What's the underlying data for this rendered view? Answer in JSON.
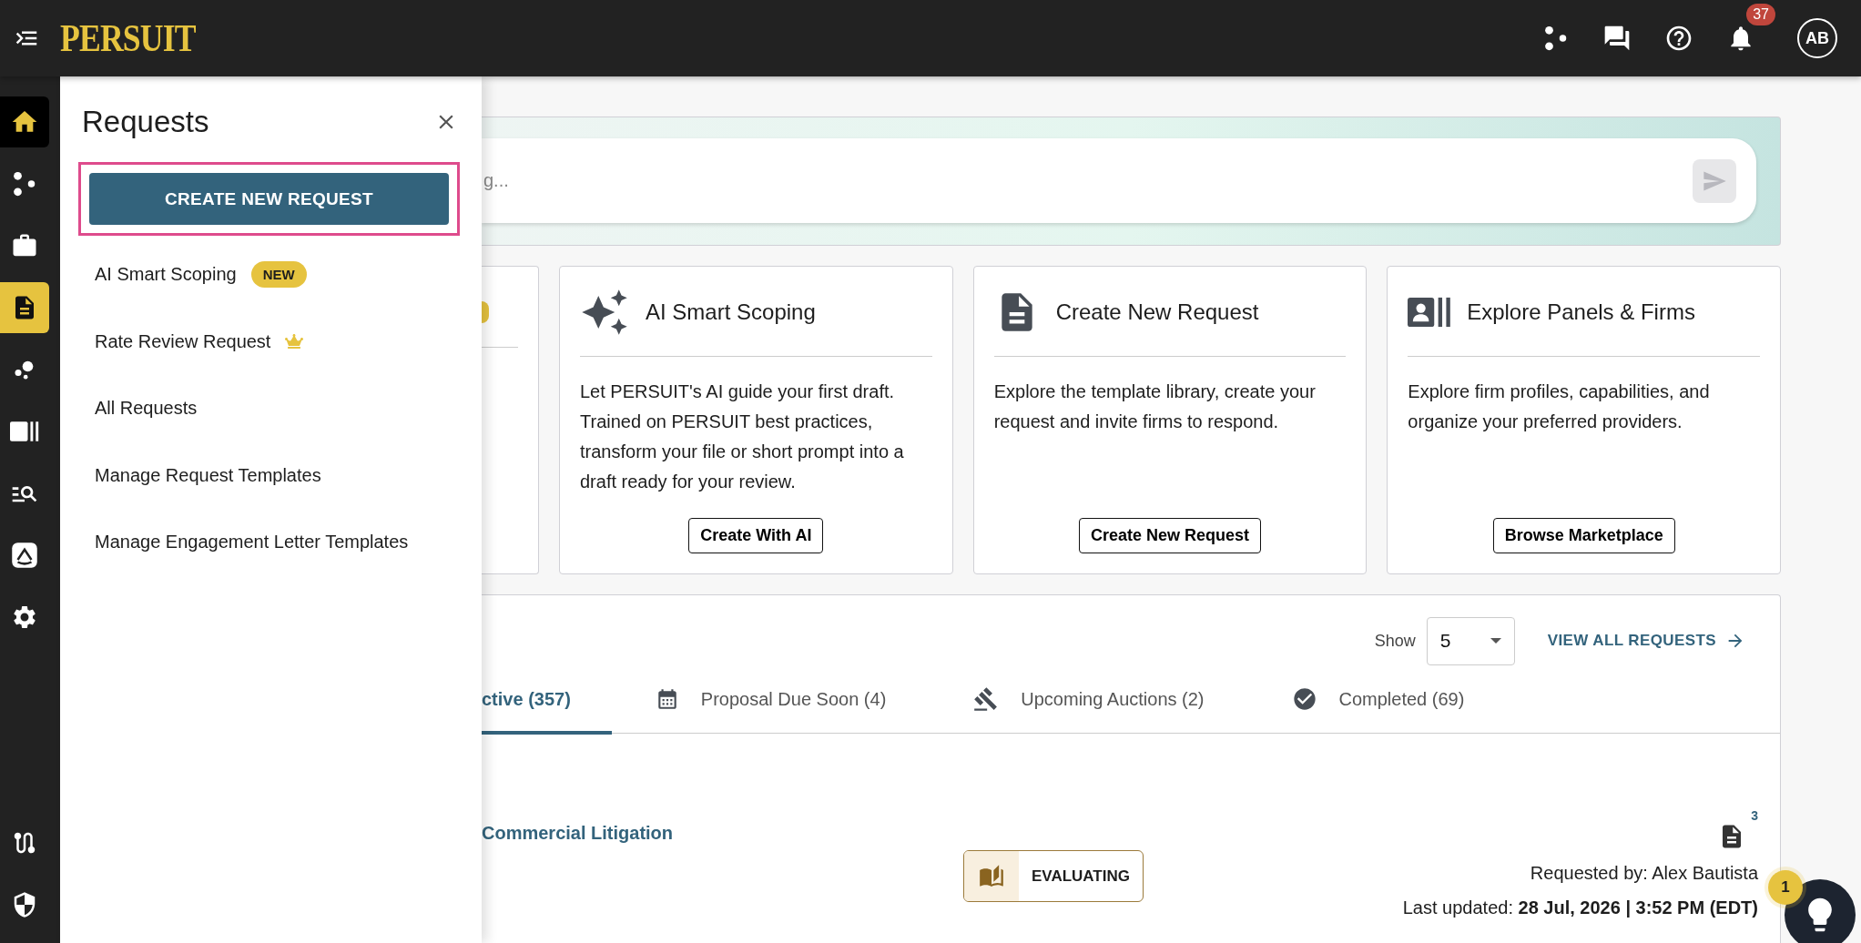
{
  "top_bar": {
    "logo": "PERSUIT",
    "notifications_badge": "37",
    "avatar_initials": "AB"
  },
  "rail": {
    "items": [
      {
        "current": true,
        "selected": false
      },
      {
        "current": false,
        "selected": false
      },
      {
        "current": false,
        "selected": false
      },
      {
        "current": false,
        "selected": true
      },
      {
        "current": false,
        "selected": false
      },
      {
        "current": false,
        "selected": false
      },
      {
        "current": false,
        "selected": false
      },
      {
        "current": false,
        "selected": false
      },
      {
        "current": false,
        "selected": false
      }
    ],
    "bottom_items": [
      {
        "current": false,
        "selected": false
      },
      {
        "current": false,
        "selected": false
      }
    ]
  },
  "flyout": {
    "title": "Requests",
    "primary_button": "CREATE NEW REQUEST",
    "primary_highlighted": true,
    "items": [
      {
        "label": "AI Smart Scoping",
        "badge": "NEW",
        "premium": false
      },
      {
        "label": "Rate Review Request",
        "premium": true
      },
      {
        "label": "All Requests",
        "premium": false
      },
      {
        "label": "Manage Request Templates",
        "premium": false
      },
      {
        "label": "Manage Engagement Letter Templates",
        "premium": false
      }
    ]
  },
  "search": {
    "placeholder": "g..."
  },
  "cards": [
    {
      "title": "AI Smart Scoping",
      "description": "Let PERSUIT's AI guide your first draft. Trained on PERSUIT best practices, transform your file or short prompt into a draft ready for your review.",
      "button": "Create With AI"
    },
    {
      "title": "Create New Request",
      "description": "Explore the template library, create your request and invite firms to respond.",
      "button": "Create New Request"
    },
    {
      "title": "Explore Panels & Firms",
      "description": "Explore firm profiles, capabilities, and organize your preferred providers.",
      "button": "Browse Marketplace"
    }
  ],
  "requests_panel": {
    "show_label": "Show",
    "page_size": "5",
    "view_all": "VIEW ALL REQUESTS",
    "tabs": [
      {
        "label": "ctive (357)",
        "selected": true
      },
      {
        "label": "Proposal Due Soon (4)",
        "selected": false
      },
      {
        "label": "Upcoming Auctions (2)",
        "selected": false
      },
      {
        "label": "Completed (69)",
        "selected": false
      }
    ],
    "rows": [
      {
        "title": "Commercial Litigation",
        "status": "EVALUATING",
        "document_count": "3",
        "requested_by": "Requested by: Alex Bautista",
        "last_updated": "Last updated: **28 Jul, 2026 | 3:52 PM (EDT)**"
      }
    ]
  },
  "help": {
    "badge": "1"
  }
}
